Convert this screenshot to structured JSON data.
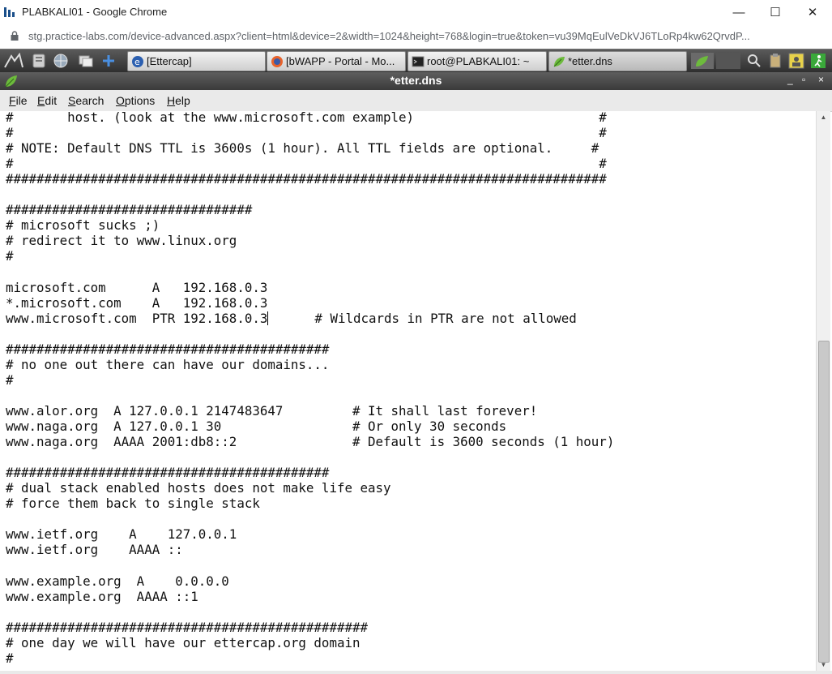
{
  "window": {
    "title": "PLABKALI01 - Google Chrome",
    "minimize_glyph": "—",
    "maximize_glyph": "☐",
    "close_glyph": "✕"
  },
  "address_bar": {
    "url": "stg.practice-labs.com/device-advanced.aspx?client=html&device=2&width=1024&height=768&login=true&token=vu39MqEulVeDkVJ6TLoRp4kw62QrvdP..."
  },
  "taskbar": {
    "tasks": [
      {
        "label": "[Ettercap]",
        "icon": "ettercap-icon"
      },
      {
        "label": "[bWAPP - Portal - Mo...",
        "icon": "firefox-icon"
      },
      {
        "label": "root@PLABKALI01: ~",
        "icon": "terminal-icon"
      },
      {
        "label": "*etter.dns",
        "icon": "leafpad-icon"
      }
    ]
  },
  "editor_window": {
    "title": "*etter.dns",
    "controls": [
      "_",
      "▫",
      "×"
    ],
    "menu": [
      {
        "label": "File",
        "accel": "F",
        "rest": "ile"
      },
      {
        "label": "Edit",
        "accel": "E",
        "rest": "dit"
      },
      {
        "label": "Search",
        "accel": "S",
        "rest": "earch"
      },
      {
        "label": "Options",
        "accel": "O",
        "rest": "ptions"
      },
      {
        "label": "Help",
        "accel": "H",
        "rest": "elp"
      }
    ]
  },
  "document": {
    "lines": [
      "#       host. (look at the www.microsoft.com example)                        #",
      "#                                                                            #",
      "# NOTE: Default DNS TTL is 3600s (1 hour). All TTL fields are optional.     #",
      "#                                                                            #",
      "##############################################################################",
      "",
      "################################",
      "# microsoft sucks ;)",
      "# redirect it to www.linux.org",
      "#",
      "",
      "microsoft.com      A   192.168.0.3",
      "*.microsoft.com    A   192.168.0.3",
      "www.microsoft.com  PTR 192.168.0.3",
      "",
      "##########################################",
      "# no one out there can have our domains...",
      "#",
      "",
      "www.alor.org  A 127.0.0.1 2147483647         # It shall last forever!",
      "www.naga.org  A 127.0.0.1 30                 # Or only 30 seconds",
      "www.naga.org  AAAA 2001:db8::2               # Default is 3600 seconds (1 hour)",
      "",
      "##########################################",
      "# dual stack enabled hosts does not make life easy",
      "# force them back to single stack",
      "",
      "www.ietf.org    A    127.0.0.1",
      "www.ietf.org    AAAA ::",
      "",
      "www.example.org  A    0.0.0.0",
      "www.example.org  AAAA ::1",
      "",
      "###############################################",
      "# one day we will have our ettercap.org domain",
      "#"
    ],
    "caret_line_suffix": "      # Wildcards in PTR are not allowed"
  }
}
